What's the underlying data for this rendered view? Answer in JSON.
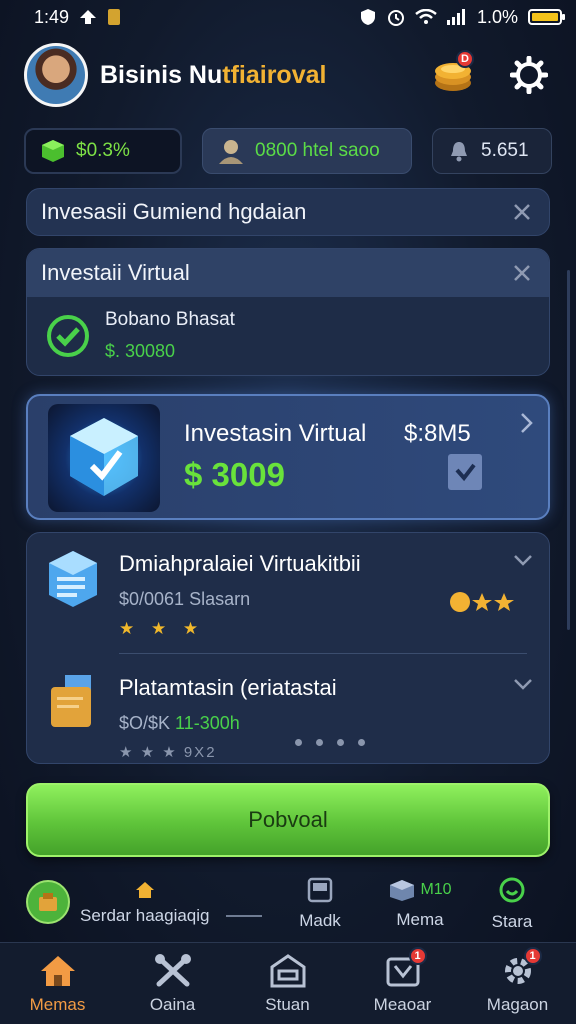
{
  "status": {
    "time": "1:49",
    "battery": "1.0%"
  },
  "header": {
    "title_a": "Bisinis Nu",
    "title_b": "tfiairoval",
    "cart_badge": "D"
  },
  "stats": [
    {
      "label": "$0.3%"
    },
    {
      "label": "0800 htel saoo"
    },
    {
      "label": "5.651"
    }
  ],
  "notice1": {
    "text": "Invesasii Gumiend hgdaian"
  },
  "notice2": {
    "title": "Investaii Virtual",
    "name": "Bobano Bhasat",
    "value": "$. 30080"
  },
  "feature": {
    "title": "Investasin Virtual",
    "price": "$:8M5",
    "amount": "$ 3009"
  },
  "list": [
    {
      "title": "Dmiahpralaiei Virtuakitbii",
      "sub": "$0/0061 Slasarn",
      "stars": "★ ★ ★"
    },
    {
      "title": "Platamtasin (eriatastai",
      "sub_a": "$O/$K",
      "sub_b": " 11-300h",
      "stars": "★ ★ ★ 9X2"
    }
  ],
  "cta": {
    "label": "Pobvoal"
  },
  "subnav": [
    {
      "label": "Serdar haagiaqig"
    },
    {
      "label": "Madk"
    },
    {
      "label": "Mema",
      "extra": "M10"
    },
    {
      "label": "Stara"
    }
  ],
  "tabs": [
    {
      "label": "Memas"
    },
    {
      "label": "Oaina"
    },
    {
      "label": "Stuan"
    },
    {
      "label": "Meaoar",
      "badge": "1"
    },
    {
      "label": "Magaon",
      "badge": "1"
    }
  ],
  "colors": {
    "accent_green": "#69e23b",
    "active_tab": "#f29b44",
    "gold": "#f2b233"
  }
}
